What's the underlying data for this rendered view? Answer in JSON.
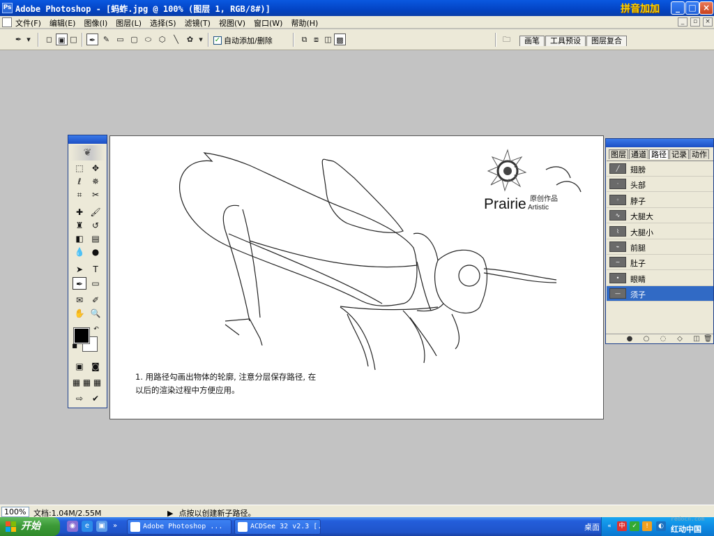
{
  "window": {
    "title": "Adobe Photoshop - [蚂蚱.jpg @ 100% (图层 1, RGB/8#)]",
    "ime_label": "拼音加加",
    "minimize": "_",
    "maximize": "□",
    "close": "×"
  },
  "menu": {
    "items": [
      "文件(F)",
      "编辑(E)",
      "图像(I)",
      "图层(L)",
      "选择(S)",
      "滤镜(T)",
      "视图(V)",
      "窗口(W)",
      "帮助(H)"
    ]
  },
  "options": {
    "auto_add_delete": "自动添加/删除",
    "auto_add_checked": true
  },
  "palette_well": {
    "tabs": [
      "画笔",
      "工具预设",
      "图层复合"
    ]
  },
  "canvas": {
    "instruction_line1": "1. 用路径勾画出物体的轮廓, 注意分层保存路径, 在",
    "instruction_line2": "以后的渲染过程中方便应用。",
    "logo_word": "Prairie",
    "logo_sub": "Artistic",
    "logo_cn": "原创作品"
  },
  "paths_panel": {
    "tabs": [
      "图层",
      "通道",
      "路径",
      "记录",
      "动作"
    ],
    "active_tab": "路径",
    "paths": [
      {
        "name": "翅膀",
        "selected": false
      },
      {
        "name": "头部",
        "selected": false
      },
      {
        "name": "脖子",
        "selected": false
      },
      {
        "name": "大腿大",
        "selected": false
      },
      {
        "name": "大腿小",
        "selected": false
      },
      {
        "name": "前腿",
        "selected": false
      },
      {
        "name": "肚子",
        "selected": false
      },
      {
        "name": "眼睛",
        "selected": false
      },
      {
        "name": "须子",
        "selected": true
      }
    ]
  },
  "status": {
    "zoom": "100%",
    "doc_size": "文档:1.04M/2.55M",
    "hint": "点按以创建新子路径。"
  },
  "taskbar": {
    "start_label": "开始",
    "tasks": [
      "Adobe Photoshop ...",
      "ACDSee 32 v2.3 [..."
    ],
    "desktop_label": "桌面",
    "watermark_url": "redocn.com",
    "watermark_brand": "红动中国"
  },
  "colors": {
    "title_blue": "#0344c4",
    "selected_row": "#316ac5",
    "start_green": "#3c9a37",
    "workspace_gray": "#c3c3c3"
  }
}
